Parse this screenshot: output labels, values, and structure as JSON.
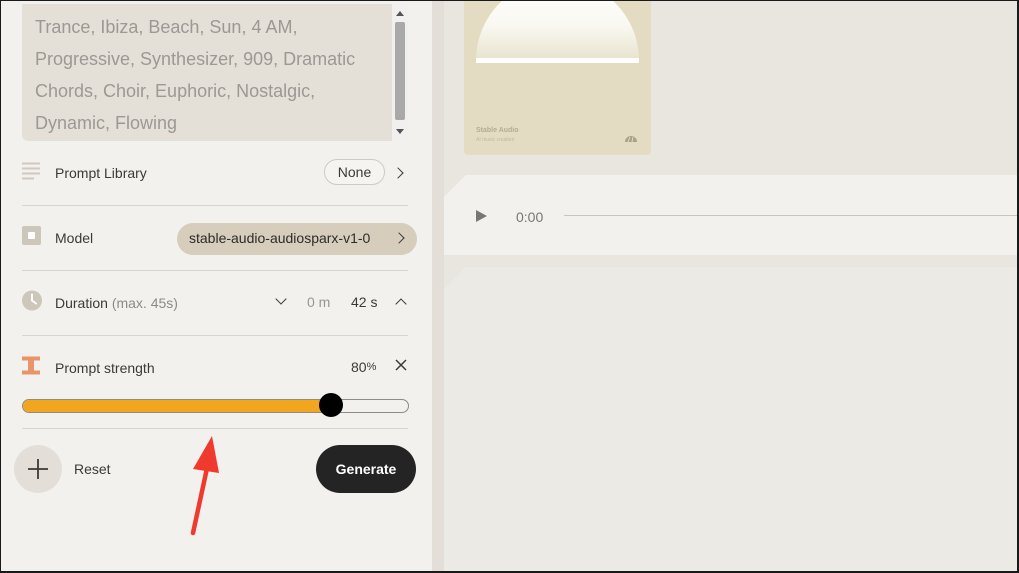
{
  "prompt": {
    "text": "Trance, Ibiza, Beach, Sun, 4 AM, Progressive, Synthesizer, 909, Dramatic Chords, Choir, Euphoric, Nostalgic, Dynamic, Flowing"
  },
  "prompt_library": {
    "label": "Prompt Library",
    "value": "None",
    "icon": "list-lines-icon"
  },
  "model": {
    "label": "Model",
    "value": "stable-audio-audiosparx-v1-0",
    "icon": "model-square-icon"
  },
  "duration": {
    "label": "Duration",
    "hint": "(max. 45s)",
    "minutes": "0 m",
    "seconds": "42 s",
    "icon": "clock-icon"
  },
  "prompt_strength": {
    "label": "Prompt strength",
    "value": "80",
    "unit": "%",
    "fraction": 0.8,
    "icon": "i-beam-icon"
  },
  "actions": {
    "reset_label": "Reset",
    "generate_label": "Generate"
  },
  "album": {
    "title": "Stable Audio",
    "subtitle": "AI music creation"
  },
  "player": {
    "time": "0:00"
  },
  "colors": {
    "accent": "#f2a51f",
    "annotation": "#f03a2e",
    "dark": "#242424"
  }
}
